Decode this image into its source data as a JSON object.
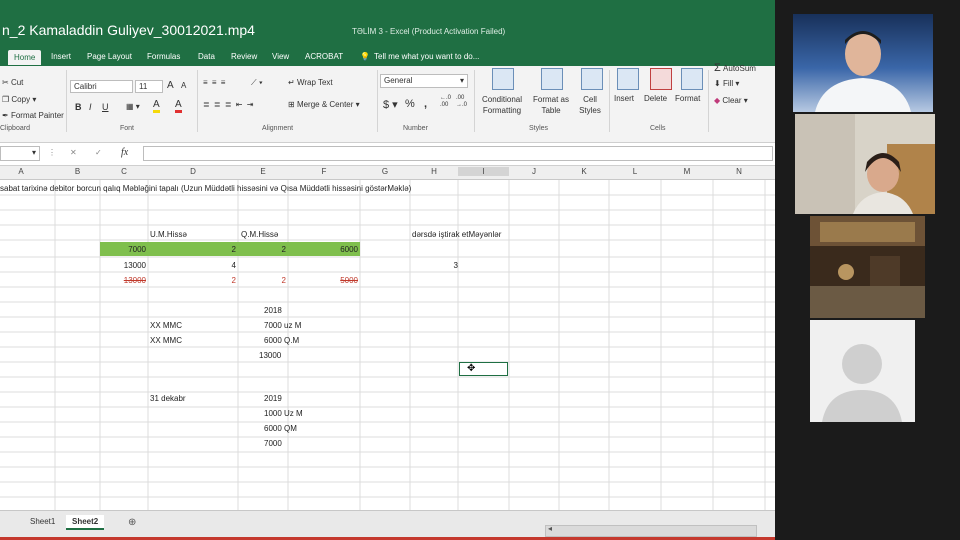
{
  "window": {
    "file_title": "n_2 Kamaladdin Guliyev_30012021.mp4",
    "app_title": "TƏLİM 3 - Excel (Product Activation Failed)"
  },
  "tabs": [
    "Home",
    "Insert",
    "Page Layout",
    "Formulas",
    "Data",
    "Review",
    "View",
    "ACROBAT"
  ],
  "tell_me": "Tell me what you want to do...",
  "ribbon": {
    "clipboard": {
      "cut": "Cut",
      "copy": "Copy",
      "format_painter": "Format Painter",
      "label": "Clipboard"
    },
    "font": {
      "name": "Calibri",
      "size": "11",
      "grow": "A",
      "shrink": "A",
      "bold": "B",
      "italic": "I",
      "underline": "U",
      "fill_icon_text": "A",
      "font_color_text": "A",
      "label": "Font"
    },
    "alignment": {
      "wrap": "Wrap Text",
      "merge": "Merge & Center",
      "label": "Alignment"
    },
    "number": {
      "format": "General",
      "currency": "$",
      "percent": "%",
      "comma": ",",
      "inc_dec": "←.0 .00",
      "dec_dec": ".00 →.0",
      "label": "Number"
    },
    "styles": {
      "conditional": "Conditional Formatting",
      "format_table": "Format as Table",
      "cell_styles": "Cell Styles",
      "label": "Styles"
    },
    "cells": {
      "insert": "Insert",
      "delete": "Delete",
      "format": "Format",
      "label": "Cells"
    },
    "editing": {
      "autosum": "AutoSum",
      "fill": "Fill",
      "clear": "Clear",
      "sigma": "Σ"
    }
  },
  "formula_bar": {
    "fx": "fx"
  },
  "columns": [
    "A",
    "B",
    "C",
    "D",
    "E",
    "F",
    "G",
    "H",
    "I",
    "J",
    "K",
    "L",
    "M",
    "N"
  ],
  "cells": {
    "r1_text": "sabat tarixinə debitor borcun qalıq Məbləğini tapalı (Uzun Müddətli hissəsini və Qısa Müddətli hissəsini göstərMəklə)",
    "um_hisse": "U.M.Hissə",
    "qm_hisse": "Q.M.Hissə",
    "derse": "dərsdə iştirak etMəyənlər",
    "green_c": "7000",
    "green_d": "2",
    "green_e": "2",
    "green_f": "6000",
    "r6_c": "13000",
    "r6_d": "4",
    "r6_h": "3",
    "red_c": "13000",
    "red_d": "2",
    "red_e": "2",
    "red_f": "5000",
    "y2018": "2018",
    "xx1": "XX MMC",
    "v7000uz": "7000 uz M",
    "xx2": "XX MMC",
    "v6000qm": "6000 Q.M",
    "v13000": "13000",
    "dec31": "31 dekabr",
    "y2019": "2019",
    "v1000uz": "1000 Uz M",
    "v6000qm2": "6000 QM",
    "v7000": "7000"
  },
  "sheets": [
    "Sheet1",
    "Sheet2"
  ],
  "colors": {
    "excel_green": "#1f6f43",
    "highlight": "#7fbf4d",
    "red_text": "#c0392b"
  }
}
